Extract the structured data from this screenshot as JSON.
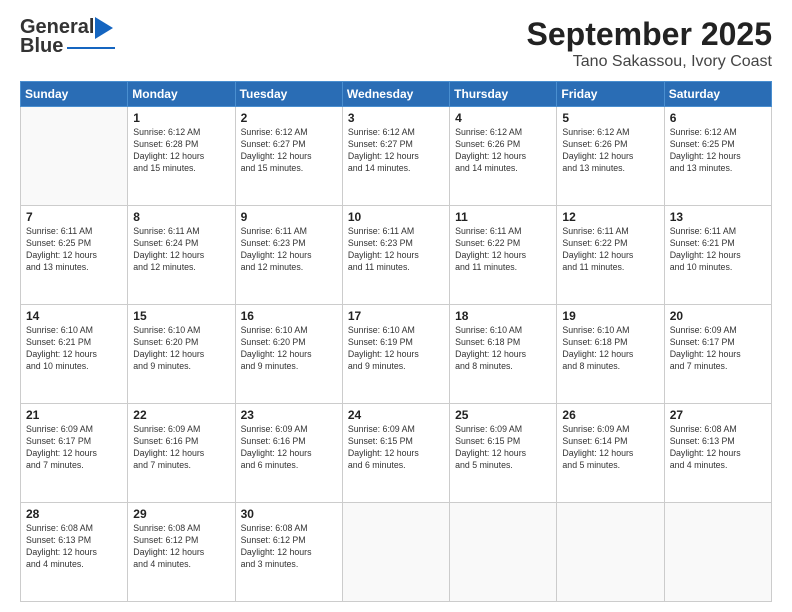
{
  "header": {
    "logo_general": "General",
    "logo_blue": "Blue",
    "title": "September 2025",
    "subtitle": "Tano Sakassou, Ivory Coast"
  },
  "days_of_week": [
    "Sunday",
    "Monday",
    "Tuesday",
    "Wednesday",
    "Thursday",
    "Friday",
    "Saturday"
  ],
  "weeks": [
    [
      {
        "day": "",
        "info": ""
      },
      {
        "day": "1",
        "info": "Sunrise: 6:12 AM\nSunset: 6:28 PM\nDaylight: 12 hours\nand 15 minutes."
      },
      {
        "day": "2",
        "info": "Sunrise: 6:12 AM\nSunset: 6:27 PM\nDaylight: 12 hours\nand 15 minutes."
      },
      {
        "day": "3",
        "info": "Sunrise: 6:12 AM\nSunset: 6:27 PM\nDaylight: 12 hours\nand 14 minutes."
      },
      {
        "day": "4",
        "info": "Sunrise: 6:12 AM\nSunset: 6:26 PM\nDaylight: 12 hours\nand 14 minutes."
      },
      {
        "day": "5",
        "info": "Sunrise: 6:12 AM\nSunset: 6:26 PM\nDaylight: 12 hours\nand 13 minutes."
      },
      {
        "day": "6",
        "info": "Sunrise: 6:12 AM\nSunset: 6:25 PM\nDaylight: 12 hours\nand 13 minutes."
      }
    ],
    [
      {
        "day": "7",
        "info": ""
      },
      {
        "day": "8",
        "info": "Sunrise: 6:11 AM\nSunset: 6:24 PM\nDaylight: 12 hours\nand 12 minutes."
      },
      {
        "day": "9",
        "info": "Sunrise: 6:11 AM\nSunset: 6:23 PM\nDaylight: 12 hours\nand 12 minutes."
      },
      {
        "day": "10",
        "info": "Sunrise: 6:11 AM\nSunset: 6:23 PM\nDaylight: 12 hours\nand 11 minutes."
      },
      {
        "day": "11",
        "info": "Sunrise: 6:11 AM\nSunset: 6:22 PM\nDaylight: 12 hours\nand 11 minutes."
      },
      {
        "day": "12",
        "info": "Sunrise: 6:11 AM\nSunset: 6:22 PM\nDaylight: 12 hours\nand 11 minutes."
      },
      {
        "day": "13",
        "info": "Sunrise: 6:11 AM\nSunset: 6:21 PM\nDaylight: 12 hours\nand 10 minutes."
      }
    ],
    [
      {
        "day": "14",
        "info": ""
      },
      {
        "day": "15",
        "info": "Sunrise: 6:10 AM\nSunset: 6:20 PM\nDaylight: 12 hours\nand 9 minutes."
      },
      {
        "day": "16",
        "info": "Sunrise: 6:10 AM\nSunset: 6:20 PM\nDaylight: 12 hours\nand 9 minutes."
      },
      {
        "day": "17",
        "info": "Sunrise: 6:10 AM\nSunset: 6:19 PM\nDaylight: 12 hours\nand 9 minutes."
      },
      {
        "day": "18",
        "info": "Sunrise: 6:10 AM\nSunset: 6:18 PM\nDaylight: 12 hours\nand 8 minutes."
      },
      {
        "day": "19",
        "info": "Sunrise: 6:10 AM\nSunset: 6:18 PM\nDaylight: 12 hours\nand 8 minutes."
      },
      {
        "day": "20",
        "info": "Sunrise: 6:09 AM\nSunset: 6:17 PM\nDaylight: 12 hours\nand 7 minutes."
      }
    ],
    [
      {
        "day": "21",
        "info": ""
      },
      {
        "day": "22",
        "info": "Sunrise: 6:09 AM\nSunset: 6:16 PM\nDaylight: 12 hours\nand 7 minutes."
      },
      {
        "day": "23",
        "info": "Sunrise: 6:09 AM\nSunset: 6:16 PM\nDaylight: 12 hours\nand 6 minutes."
      },
      {
        "day": "24",
        "info": "Sunrise: 6:09 AM\nSunset: 6:15 PM\nDaylight: 12 hours\nand 6 minutes."
      },
      {
        "day": "25",
        "info": "Sunrise: 6:09 AM\nSunset: 6:15 PM\nDaylight: 12 hours\nand 5 minutes."
      },
      {
        "day": "26",
        "info": "Sunrise: 6:09 AM\nSunset: 6:14 PM\nDaylight: 12 hours\nand 5 minutes."
      },
      {
        "day": "27",
        "info": "Sunrise: 6:08 AM\nSunset: 6:13 PM\nDaylight: 12 hours\nand 4 minutes."
      }
    ],
    [
      {
        "day": "28",
        "info": "Sunrise: 6:08 AM\nSunset: 6:13 PM\nDaylight: 12 hours\nand 4 minutes."
      },
      {
        "day": "29",
        "info": "Sunrise: 6:08 AM\nSunset: 6:12 PM\nDaylight: 12 hours\nand 4 minutes."
      },
      {
        "day": "30",
        "info": "Sunrise: 6:08 AM\nSunset: 6:12 PM\nDaylight: 12 hours\nand 3 minutes."
      },
      {
        "day": "",
        "info": ""
      },
      {
        "day": "",
        "info": ""
      },
      {
        "day": "",
        "info": ""
      },
      {
        "day": "",
        "info": ""
      }
    ]
  ],
  "week7_sunday_info": "Sunrise: 6:11 AM\nSunset: 6:25 PM\nDaylight: 12 hours\nand 13 minutes.",
  "week14_sunday_info": "Sunrise: 6:10 AM\nSunset: 6:21 PM\nDaylight: 12 hours\nand 10 minutes.",
  "week21_sunday_info": "Sunrise: 6:09 AM\nSunset: 6:17 PM\nDaylight: 12 hours\nand 7 minutes."
}
